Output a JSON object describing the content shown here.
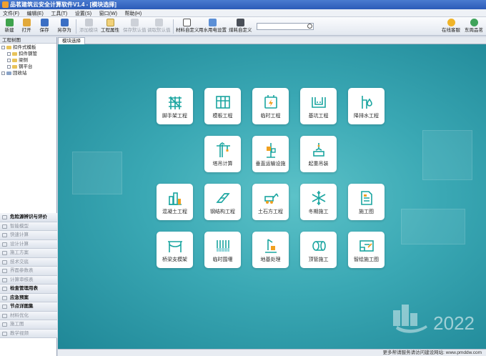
{
  "app": {
    "title": "品茗建筑云安全计算软件V1.4 - [模块选择]"
  },
  "menu": [
    "文件(F)",
    "编辑(E)",
    "工具(T)",
    "设置(S)",
    "窗口(W)",
    "帮助(H)"
  ],
  "toolbar": {
    "new": "新建",
    "open": "打开",
    "save": "保存",
    "save_as": "另存为",
    "add_module": "添加模块",
    "project_props": "工程属性",
    "save_default": "保存默认值",
    "load_default": "调取默认值",
    "material_custom": "材料自定义",
    "water_power": "用水用电设置",
    "coal_custom": "煤耗自定义",
    "online_service": "在线客服",
    "user": "东周品茗"
  },
  "search": {
    "value": ""
  },
  "tree": {
    "header": "工程树图",
    "items": [
      "扣件式模板",
      "扣件钢管",
      "梁侧",
      "钢平台",
      "回收站"
    ]
  },
  "nav": [
    {
      "label": "危险源辨识与评价",
      "active": true
    },
    {
      "label": "智能模型",
      "active": false
    },
    {
      "label": "快速计算",
      "active": false
    },
    {
      "label": "设计计算",
      "active": false
    },
    {
      "label": "施工方案",
      "active": false
    },
    {
      "label": "技术交底",
      "active": false
    },
    {
      "label": "界面参数表",
      "active": false
    },
    {
      "label": "计算审核表",
      "active": false
    },
    {
      "label": "检查管理用表",
      "active": true
    },
    {
      "label": "应急预案",
      "active": true
    },
    {
      "label": "节点详图集",
      "active": true
    },
    {
      "label": "材料优化",
      "active": false
    },
    {
      "label": "施工图",
      "active": false
    },
    {
      "label": "教学视频",
      "active": false
    }
  ],
  "tabs": {
    "module_select": "模块选择"
  },
  "tiles": [
    {
      "label": "脚手架工程",
      "icon": "scaffold-icon"
    },
    {
      "label": "模板工程",
      "icon": "formwork-icon"
    },
    {
      "label": "临时工程",
      "icon": "temporary-power-icon"
    },
    {
      "label": "基坑工程",
      "icon": "foundation-pit-icon"
    },
    {
      "label": "降排水工程",
      "icon": "drainage-icon"
    },
    {
      "label": "塔吊计算",
      "icon": "tower-crane-icon"
    },
    {
      "label": "垂直运输设施",
      "icon": "vertical-transport-icon"
    },
    {
      "label": "起重吊装",
      "icon": "hoisting-icon"
    },
    {
      "label": "混凝土工程",
      "icon": "concrete-icon"
    },
    {
      "label": "钢结构工程",
      "icon": "steel-structure-icon"
    },
    {
      "label": "土石方工程",
      "icon": "earthwork-icon"
    },
    {
      "label": "冬期施工",
      "icon": "winter-construction-icon"
    },
    {
      "label": "施工图",
      "icon": "construction-drawing-icon"
    },
    {
      "label": "桥梁支模架",
      "icon": "bridge-formwork-icon"
    },
    {
      "label": "临时围堰",
      "icon": "cofferdam-icon"
    },
    {
      "label": "地基处理",
      "icon": "foundation-treatment-icon"
    },
    {
      "label": "顶管施工",
      "icon": "pipe-jacking-icon"
    },
    {
      "label": "智绘施工图",
      "icon": "smart-drawing-icon"
    }
  ],
  "brand": {
    "year": "2022"
  },
  "status": {
    "text": "更多帮请服务请访问建设网站: www.pmddw.com"
  },
  "colors": {
    "accent": "#2aa6ad",
    "titlebar": "#2b5bb8"
  }
}
